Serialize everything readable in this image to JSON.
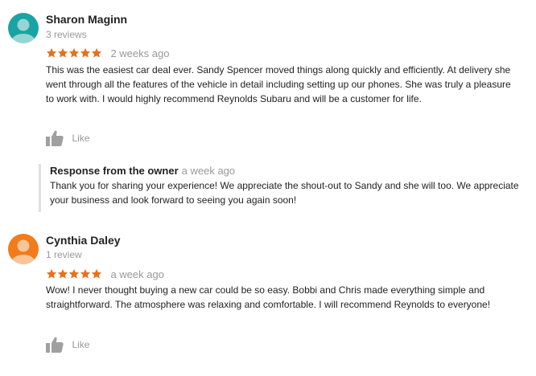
{
  "reviews": [
    {
      "name": "Sharon Maginn",
      "review_count": "3 reviews",
      "rating": 5,
      "date": "2 weeks ago",
      "avatar_color": "#1aa3a3",
      "avatar_icon": "person-icon",
      "text": "This was the easiest car deal ever.  Sandy Spencer moved things along quickly and efficiently.  At delivery she went through all the features of the vehicle in detail including setting up our phones.  She was truly a pleasure to work with.  I would highly recommend Reynolds Subaru and will be a customer for life.",
      "like_label": "Like",
      "owner_response": {
        "title": "Response from the owner",
        "date": "a week ago",
        "text": "Thank you for sharing your experience! We appreciate the shout-out to Sandy and she will too. We appreciate your business and look forward to seeing you again soon!"
      }
    },
    {
      "name": "Cynthia Daley",
      "review_count": "1 review",
      "rating": 5,
      "date": "a week ago",
      "avatar_color": "#f07c1b",
      "avatar_icon": "person-icon",
      "text": "Wow!  I never thought buying a new car could be so easy.  Bobbi and Chris made everything simple and straightforward.  The atmosphere was relaxing and comfortable.  I will recommend Reynolds to everyone!",
      "like_label": "Like"
    }
  ],
  "colors": {
    "star": "#e7711b",
    "muted_text": "#999999",
    "like_icon": "#a0a0a0"
  },
  "icons": {
    "star": "star-icon",
    "like": "thumbs-up-icon"
  }
}
